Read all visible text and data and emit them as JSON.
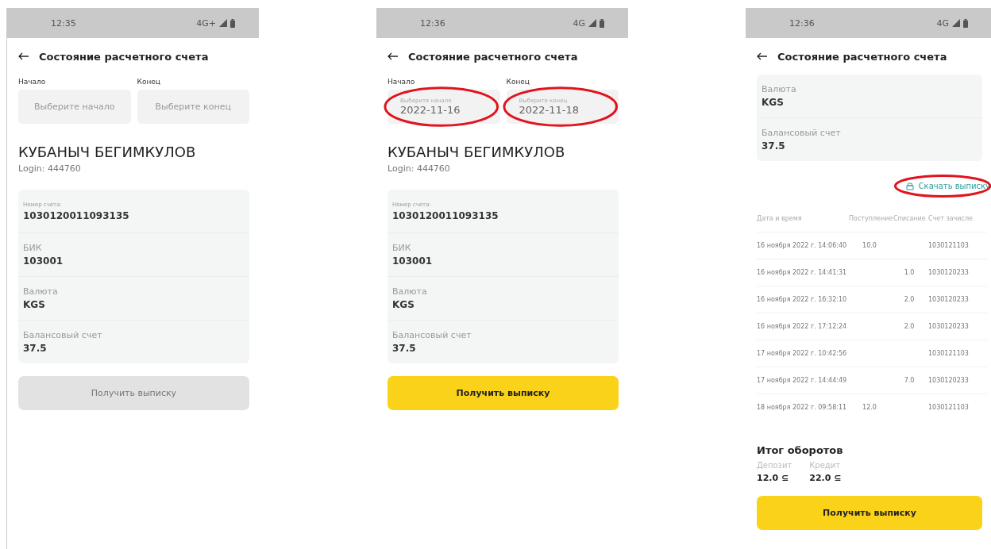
{
  "screens": [
    {
      "status": {
        "time": "12:35",
        "network": "4G+"
      },
      "title": "Состояние расчетного счета",
      "period": {
        "start": {
          "label": "Начало",
          "placeholder": "Выберите начало",
          "circled": false
        },
        "end": {
          "label": "Конец",
          "placeholder": "Выберите конец",
          "circled": false
        }
      },
      "user": {
        "name": "КУБАНЫЧ БЕГИМКУЛОВ",
        "login": "Login: 444760"
      },
      "fields": [
        {
          "label": "Номер счета:",
          "value": "1030120011093135",
          "small_label": true
        },
        {
          "label": "БИК",
          "value": "103001",
          "small_label": false
        },
        {
          "label": "Валюта",
          "value": "KGS",
          "small_label": false
        },
        {
          "label": "Балансовый счет",
          "value": "37.5",
          "small_label": false
        }
      ],
      "button": {
        "label": "Получить выписку",
        "disabled": true
      }
    },
    {
      "status": {
        "time": "12:36",
        "network": "4G"
      },
      "title": "Состояние расчетного счета",
      "period": {
        "start": {
          "label": "Начало",
          "placeholder": "Выберите начало",
          "value": "2022-11-16",
          "circled": true
        },
        "end": {
          "label": "Конец",
          "placeholder": "Выберите конец",
          "value": "2022-11-18",
          "circled": true
        }
      },
      "user": {
        "name": "КУБАНЫЧ БЕГИМКУЛОВ",
        "login": "Login: 444760"
      },
      "fields": [
        {
          "label": "Номер счета:",
          "value": "1030120011093135",
          "small_label": true
        },
        {
          "label": "БИК",
          "value": "103001",
          "small_label": false
        },
        {
          "label": "Валюта",
          "value": "KGS",
          "small_label": false
        },
        {
          "label": "Балансовый счет",
          "value": "37.5",
          "small_label": false
        }
      ],
      "button": {
        "label": "Получить выписку",
        "disabled": false
      }
    },
    {
      "status": {
        "time": "12:36",
        "network": "4G"
      },
      "title": "Состояние расчетного счета",
      "fields": [
        {
          "label": "Валюта",
          "value": "KGS",
          "small_label": false
        },
        {
          "label": "Балансовый счет",
          "value": "37.5",
          "small_label": false
        }
      ],
      "download": {
        "label": "Скачать выписку",
        "circled": true
      },
      "table": {
        "columns": [
          "Дата и время",
          "Поступление",
          "Списание",
          "Счет зачисле"
        ],
        "rows": [
          {
            "datetime": "16 ноября 2022 г. 14:06:40",
            "income": "10.0",
            "account": "1030121103"
          },
          {
            "datetime": "16 ноября 2022 г. 14:41:31",
            "expense": "1.0",
            "account": "1030120233"
          },
          {
            "datetime": "16 ноября 2022 г. 16:32:10",
            "expense": "2.0",
            "account": "1030120233"
          },
          {
            "datetime": "16 ноября 2022 г. 17:12:24",
            "expense": "2.0",
            "account": "1030120233"
          },
          {
            "datetime": "17 ноября 2022 г. 10:42:56",
            "account": "1030121103"
          },
          {
            "datetime": "17 ноября 2022 г. 14:44:49",
            "expense": "7.0",
            "account": "1030120233"
          },
          {
            "datetime": "18 ноября 2022 г. 09:58:11",
            "income": "12.0",
            "account": "1030121103"
          }
        ]
      },
      "totals": {
        "title": "Итог оборотов",
        "items": [
          {
            "label": "Депозит",
            "value": "12.0 ⊆"
          },
          {
            "label": "Кредит",
            "value": "22.0 ⊆"
          }
        ]
      },
      "button": {
        "label": "Получить выписку",
        "disabled": false
      }
    }
  ]
}
